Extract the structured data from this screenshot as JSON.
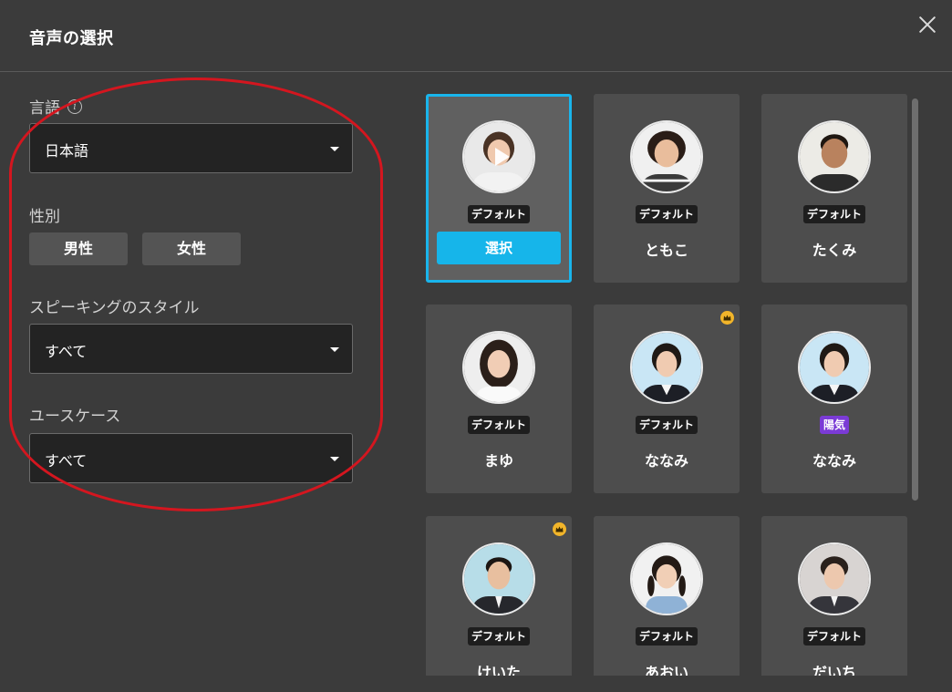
{
  "dialog": {
    "title": "音声の選択",
    "close_icon": "close-icon"
  },
  "filters": {
    "language": {
      "label": "言語",
      "info_icon": "info-icon",
      "value": "日本語"
    },
    "gender": {
      "label": "性別",
      "options": [
        "男性",
        "女性"
      ]
    },
    "speaking_style": {
      "label": "スピーキングのスタイル",
      "value": "すべて"
    },
    "use_case": {
      "label": "ユースケース",
      "value": "すべて"
    }
  },
  "highlight_color": "#d4161f",
  "accent_color": "#19b5ec",
  "voices": [
    {
      "name": "",
      "badge": "デフォルト",
      "selected": true,
      "action": "選択",
      "premium": false,
      "avatar": "woman-short-hair"
    },
    {
      "name": "ともこ",
      "badge": "デフォルト",
      "selected": false,
      "premium": false,
      "avatar": "woman-curly-hair"
    },
    {
      "name": "たくみ",
      "badge": "デフォルト",
      "selected": false,
      "premium": false,
      "avatar": "man-short-hair"
    },
    {
      "name": "まゆ",
      "badge": "デフォルト",
      "selected": false,
      "premium": false,
      "avatar": "woman-long-hair"
    },
    {
      "name": "ななみ",
      "badge": "デフォルト",
      "selected": false,
      "premium": true,
      "avatar": "woman-business"
    },
    {
      "name": "ななみ",
      "badge": "陽気",
      "badge_color": "#7b3bd6",
      "selected": false,
      "premium": false,
      "avatar": "woman-business"
    },
    {
      "name": "けいた",
      "badge": "デフォルト",
      "selected": false,
      "premium": true,
      "avatar": "man-business"
    },
    {
      "name": "あおい",
      "badge": "デフォルト",
      "selected": false,
      "premium": false,
      "avatar": "girl-pigtails"
    },
    {
      "name": "だいち",
      "badge": "デフォルト",
      "selected": false,
      "premium": false,
      "avatar": "man-suit"
    }
  ]
}
